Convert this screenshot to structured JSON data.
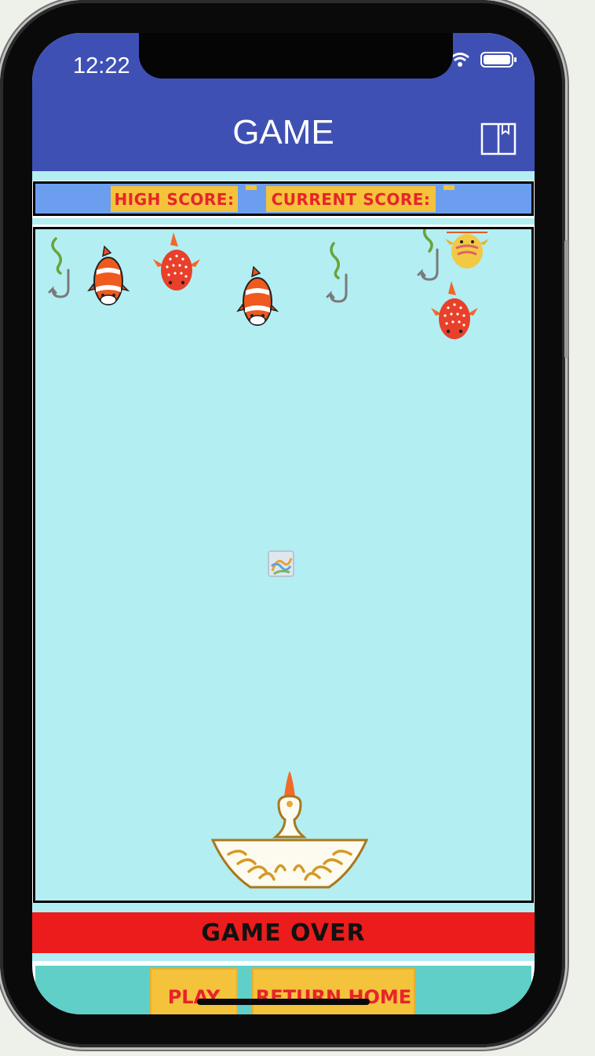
{
  "status_bar": {
    "time": "12:22"
  },
  "header": {
    "title": "GAME",
    "book_icon": "book-icon"
  },
  "scoreboard": {
    "high_score_label": "HIGH SCORE:",
    "high_score_value": "",
    "current_score_label": "CURRENT SCORE:",
    "current_score_value": ""
  },
  "game": {
    "sprites": [
      "fishing-hook",
      "clownfish",
      "red-spotted-fish",
      "clownfish",
      "fishing-hook",
      "fishing-hook",
      "yellow-fish",
      "red-spotted-fish",
      "broken-image",
      "pelican"
    ]
  },
  "status_message": "GAME OVER",
  "controls": {
    "play_label": "PLAY",
    "return_home_label": "RETURN HOME"
  },
  "colors": {
    "header": "#3f50b5",
    "water": "#b3eef3",
    "score_bar": "#6c9ef0",
    "label_bg": "#f4c33b",
    "label_text": "#e8232c",
    "game_over_bar": "#ed1c1c",
    "bottom_bar": "#5fcfc8"
  }
}
